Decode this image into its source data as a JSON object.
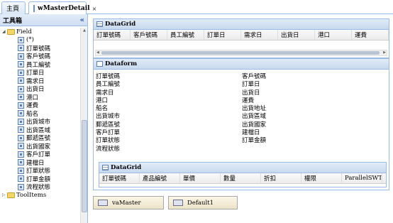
{
  "tabs": [
    {
      "label": "主頁",
      "active": false
    },
    {
      "label": "wMasterDetail",
      "active": true,
      "close": "×"
    }
  ],
  "toolbox": {
    "title": "工具箱",
    "collapse": "«",
    "root": "Field",
    "fields": [
      "(*)",
      "訂單號碼",
      "客戶號碼",
      "員工編號",
      "訂單日",
      "需求日",
      "出貨日",
      "港口",
      "運費",
      "船名",
      "出貨城市",
      "出貨區域",
      "郵遞區號",
      "出貨國家",
      "客戶訂單",
      "建檔日",
      "訂單狀態",
      "訂單金額",
      "流程狀態"
    ],
    "bottom_folder": "ToolItems"
  },
  "master_grid": {
    "title": "DataGrid",
    "columns": [
      "訂單號碼",
      "客戶號碼",
      "員工編號",
      "訂單日",
      "需求日",
      "出貨日",
      "港口",
      "運費"
    ]
  },
  "dataform": {
    "title": "Dataform",
    "left": [
      "訂單號碼",
      "員工編號",
      "需求日",
      "港口",
      "船名",
      "出貨城市",
      "郵遞區號",
      "客戶訂單",
      "訂單狀態",
      "流程狀態"
    ],
    "right": [
      "客戶號碼",
      "訂單日",
      "出貨日",
      "運費",
      "出貨地址",
      "出貨區域",
      "出貨國家",
      "建檔日",
      "訂單金額"
    ]
  },
  "detail_grid": {
    "title": "DataGrid",
    "columns": [
      "訂單號碼",
      "產品編號",
      "單價",
      "數量",
      "折扣",
      "權限",
      "ParallelSWT"
    ]
  },
  "buttons": {
    "va_master": "vaMaster",
    "default1": "Default1"
  }
}
